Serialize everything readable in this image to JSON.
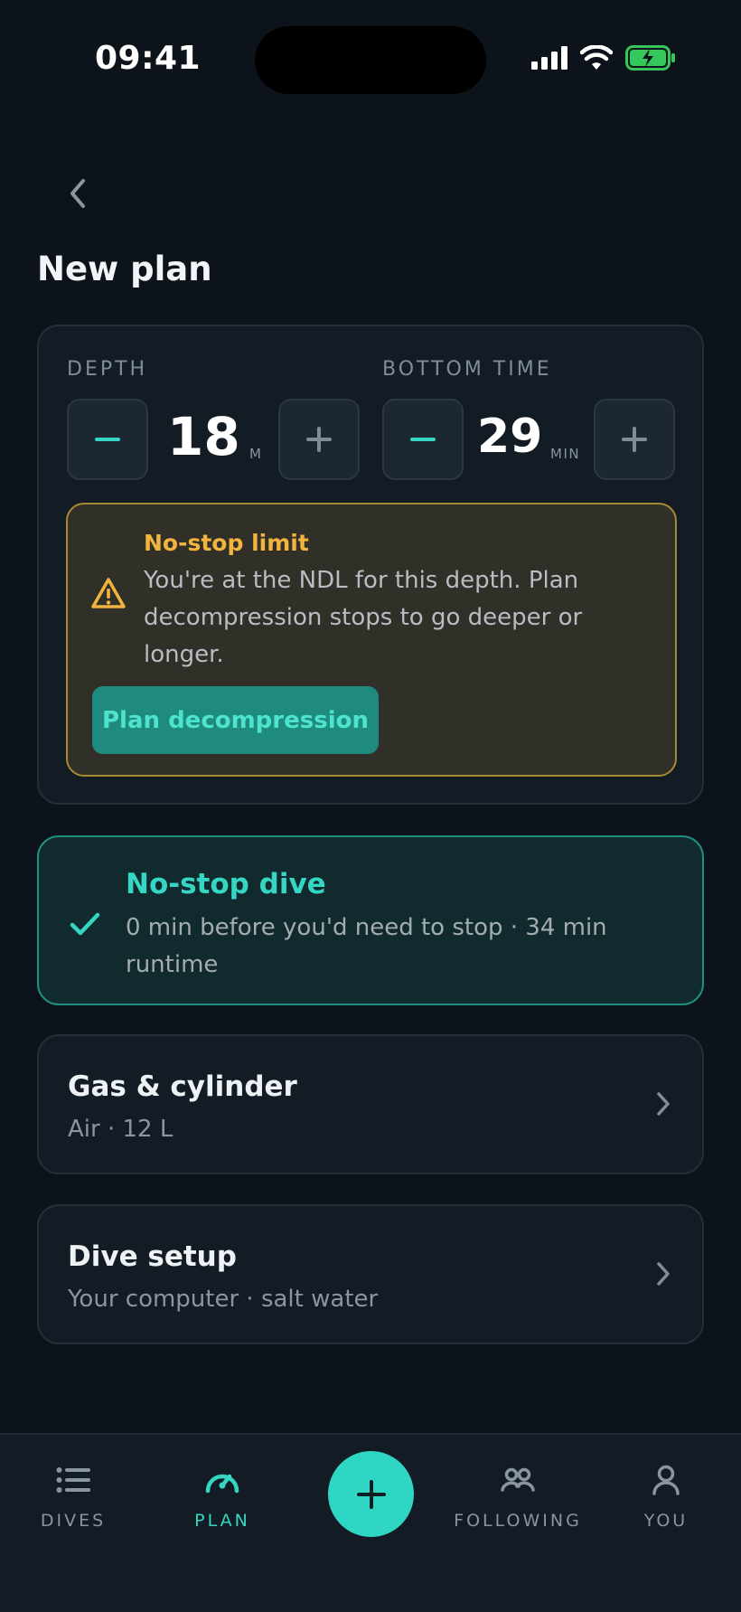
{
  "status_bar": {
    "time": "09:41"
  },
  "header": {
    "title": "New plan"
  },
  "depth": {
    "label": "DEPTH",
    "value": "18",
    "unit": "M"
  },
  "bottom_time": {
    "label": "BOTTOM TIME",
    "value": "29",
    "unit": "MIN"
  },
  "warning": {
    "title": "No-stop limit",
    "text": "You're at the NDL for this depth. Plan decompression stops to go deeper or longer.",
    "button_label": "Plan decompression"
  },
  "no_stop": {
    "title": "No-stop dive",
    "subtitle": "0 min before you'd need to stop · 34 min runtime"
  },
  "gas": {
    "title": "Gas & cylinder",
    "subtitle": "Air · 12 L"
  },
  "setup": {
    "title": "Dive setup",
    "subtitle": "Your computer · salt water"
  },
  "tabs": [
    {
      "label": "DIVES",
      "icon": "list-icon"
    },
    {
      "label": "PLAN",
      "icon": "gauge-icon",
      "active": true
    },
    {
      "label": "",
      "icon": "plus-icon"
    },
    {
      "label": "FOLLOWING",
      "icon": "people-icon"
    },
    {
      "label": "YOU",
      "icon": "person-icon"
    }
  ],
  "colors": {
    "background": "#0d131a",
    "accent": "#35d6c3",
    "warning": "#f3b43d",
    "card": "#131b24"
  }
}
